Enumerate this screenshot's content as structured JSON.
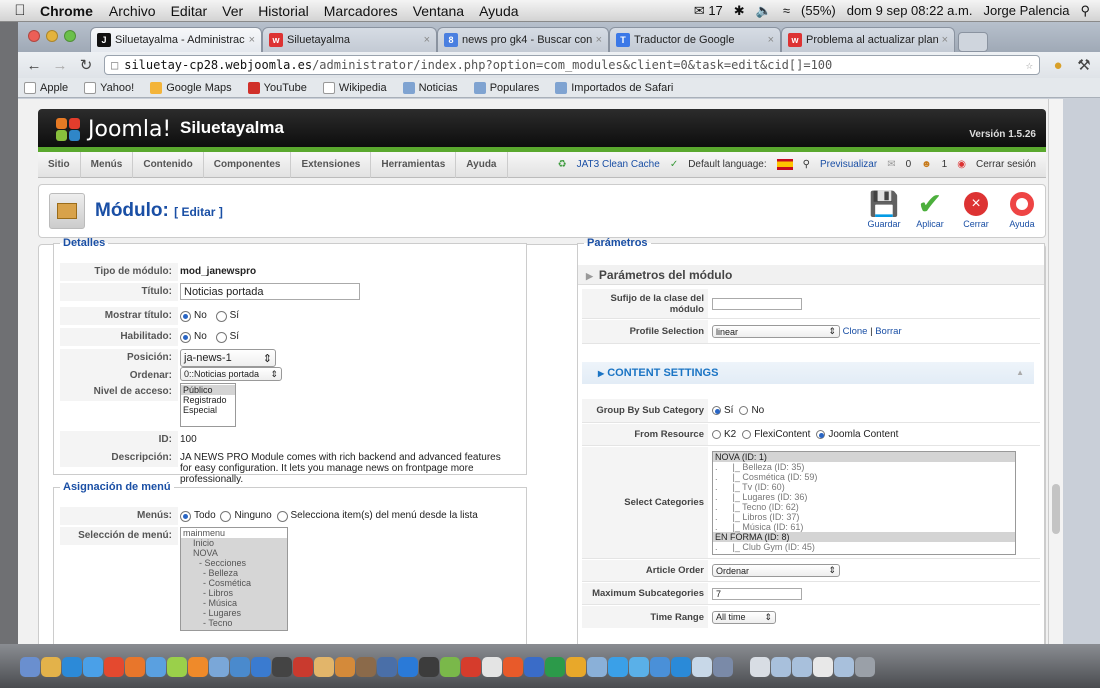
{
  "os_menubar": {
    "app": "Chrome",
    "menus": [
      "Archivo",
      "Editar",
      "Ver",
      "Historial",
      "Marcadores",
      "Ventana",
      "Ayuda"
    ],
    "status": {
      "mail_count": "17",
      "battery": "(55%)",
      "datetime": "dom 9 sep  08:22 a.m.",
      "user": "Jorge Palencia"
    }
  },
  "browser": {
    "tabs": [
      {
        "title": "Siluetayalma - Administraci",
        "active": true
      },
      {
        "title": "Siluetayalma",
        "active": false
      },
      {
        "title": "news pro gk4 - Buscar con G",
        "active": false
      },
      {
        "title": "Traductor de Google",
        "active": false
      },
      {
        "title": "Problema al actualizar planti",
        "active": false
      }
    ],
    "url_host": "siluetay-cp28.webjoomla.es",
    "url_path": "/administrator/index.php?option=com_modules&client=0&task=edit&cid[]=100",
    "bookmarks": [
      "Apple",
      "Yahoo!",
      "Google Maps",
      "YouTube",
      "Wikipedia",
      "Noticias",
      "Populares",
      "Importados de Safari"
    ]
  },
  "joomla": {
    "logo": "Joomla!",
    "site": "Siluetayalma",
    "version": "Versión 1.5.26",
    "menu": [
      "Sitio",
      "Menús",
      "Contenido",
      "Componentes",
      "Extensiones",
      "Herramientas",
      "Ayuda"
    ],
    "status": {
      "cache": "JAT3 Clean Cache",
      "lang": "Default language:",
      "preview": "Previsualizar",
      "msgs": "0",
      "users": "1",
      "logout": "Cerrar sesión"
    },
    "title": "Módulo:",
    "subtitle": "[ Editar ]",
    "toolbar": [
      "Guardar",
      "Aplicar",
      "Cerrar",
      "Ayuda"
    ]
  },
  "detalles": {
    "legend": "Detalles",
    "tipo_label": "Tipo de módulo:",
    "tipo_value": "mod_janewspro",
    "titulo_label": "Título:",
    "titulo_value": "Noticias portada",
    "mostrar_label": "Mostrar título:",
    "no": "No",
    "si": "Sí",
    "habilitado_label": "Habilitado:",
    "posicion_label": "Posición:",
    "posicion_value": "ja-news-1",
    "ordenar_label": "Ordenar:",
    "ordenar_value": "0::Noticias portada",
    "acceso_label": "Nivel de acceso:",
    "acceso_options": [
      "Público",
      "Registrado",
      "Especial"
    ],
    "id_label": "ID:",
    "id_value": "100",
    "desc_label": "Descripción:",
    "desc_value": "JA NEWS PRO Module comes with rich backend and advanced features for easy configuration. It lets you manage news on frontpage more professionally."
  },
  "asignacion": {
    "legend": "Asignación de menú",
    "menus_label": "Menús:",
    "todo": "Todo",
    "ninguno": "Ninguno",
    "selecciona": "Selecciona item(s) del menú desde la lista",
    "seleccion_label": "Selección de menú:",
    "items": [
      "mainmenu",
      "Inicio",
      "NOVA",
      "- Secciones",
      "- Belleza",
      "- Cosmética",
      "- Libros",
      "- Música",
      "- Lugares",
      "- Tecno"
    ]
  },
  "parametros": {
    "legend": "Parámetros",
    "header": "Parámetros del módulo",
    "sufijo_label": "Sufijo de la clase del módulo",
    "profile_label": "Profile Selection",
    "profile_value": "linear",
    "clone": "Clone",
    "borrar": "Borrar",
    "content_settings": "CONTENT SETTINGS",
    "group_label": "Group By Sub Category",
    "si": "Sí",
    "no": "No",
    "from_label": "From Resource",
    "k2": "K2",
    "flexi": "FlexiContent",
    "joomla": "Joomla Content",
    "cats_label": "Select Categories",
    "categories": [
      "NOVA (ID: 1)",
      ".      |_ Belleza (ID: 35)",
      ".      |_ Cosmética (ID: 59)",
      ".      |_ Tv (ID: 60)",
      ".      |_ Lugares (ID: 36)",
      ".      |_ Tecno (ID: 62)",
      ".      |_ Libros (ID: 37)",
      ".      |_ Música (ID: 61)",
      "EN FORMA (ID: 8)",
      ".      |_ Club Gym (ID: 45)"
    ],
    "order_label": "Article Order",
    "order_value": "Ordenar",
    "max_label": "Maximum Subcategories",
    "max_value": "7",
    "time_label": "Time Range",
    "time_value": "All time"
  }
}
